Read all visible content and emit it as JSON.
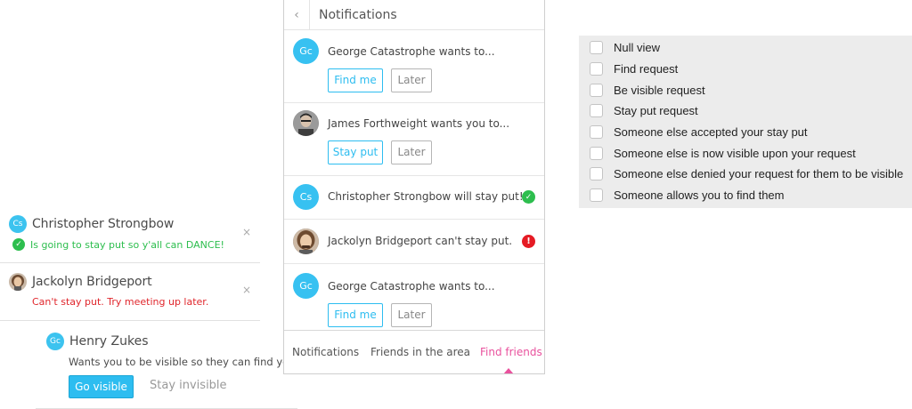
{
  "toasts": [
    {
      "avatar_initials": "Cs",
      "name": "Christopher Strongbow",
      "message": "Is going to stay put so y'all can DANCE!",
      "status_icon": "check-icon",
      "close_symbol": "×"
    },
    {
      "avatar_icon": "person-photo-avatar",
      "name": "Jackolyn Bridgeport",
      "message": "Can't stay put. Try meeting up later.",
      "close_symbol": "×"
    }
  ],
  "request_card": {
    "avatar_initials": "Gc",
    "name": "Henry Zukes",
    "message": "Wants you to be visible so they can find you.",
    "primary_label": "Go visible",
    "secondary_label": "Stay invisible"
  },
  "phone": {
    "back_symbol": "‹",
    "title": "Notifications",
    "notifications": [
      {
        "avatar_initials": "Gc",
        "text": "George Catastrophe wants to...",
        "primary": "Find me",
        "secondary": "Later"
      },
      {
        "avatar_icon": "person-photo-avatar",
        "text": "James Forthweight wants you to...",
        "primary": "Stay put",
        "secondary": "Later"
      },
      {
        "avatar_initials": "Cs",
        "text": "Christopher Strongbow will stay put!",
        "status": "check-icon",
        "status_symbol": "✓"
      },
      {
        "avatar_icon": "person-photo-avatar",
        "text": "Jackolyn Bridgeport can't stay put.",
        "status": "error-icon",
        "status_symbol": "!"
      },
      {
        "avatar_initials": "Gc",
        "text": "George Catastrophe wants to...",
        "primary": "Find me",
        "secondary": "Later"
      }
    ],
    "tabs": [
      "Notifications",
      "Friends in the area",
      "Find friends"
    ],
    "active_tab": "Find friends",
    "accent_color": "#e9519d",
    "primary_color": "#2dbdf0"
  },
  "checkbox_options": [
    "Null view",
    "Find request",
    "Be visible request",
    "Stay put request",
    "Someone else accepted your stay put",
    "Someone else is now visible upon your request",
    "Someone else denied your request for them to be visible",
    "Someone allows you to find them"
  ]
}
